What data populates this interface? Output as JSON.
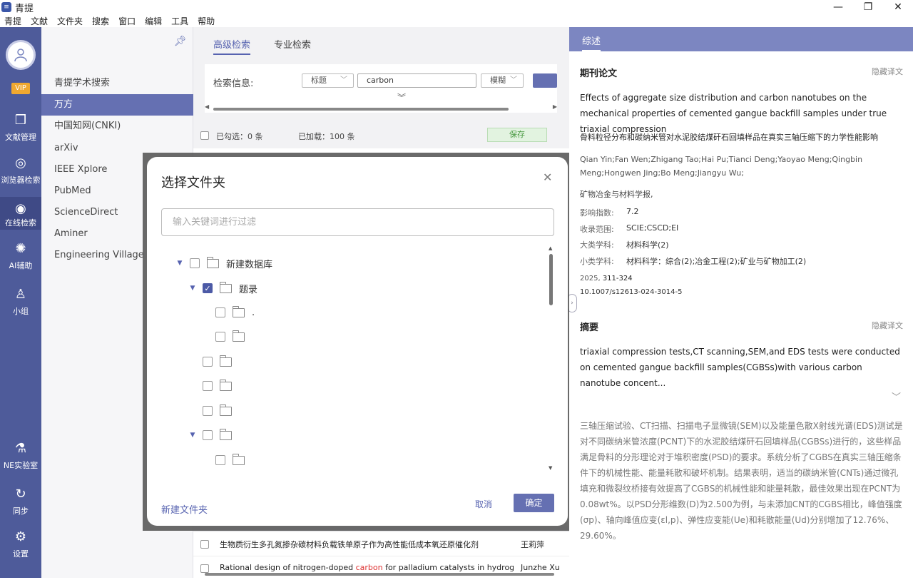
{
  "app": {
    "title": "青提",
    "logo_glyph": "≡"
  },
  "window_controls": {
    "minimize": "—",
    "maximize": "❐",
    "close": "✕"
  },
  "menu": [
    "青提",
    "文献",
    "文件夹",
    "搜索",
    "窗口",
    "编辑",
    "工具",
    "帮助"
  ],
  "rail": {
    "vip": "VIP",
    "items": [
      {
        "label": "文献管理",
        "icon": "box-icon"
      },
      {
        "label": "浏览器检索",
        "icon": "globe-icon"
      },
      {
        "label": "在线检索",
        "icon": "eye-icon"
      },
      {
        "label": "AI辅助",
        "icon": "bulb-icon"
      },
      {
        "label": "小组",
        "icon": "group-icon"
      },
      {
        "label": "NE实验室",
        "icon": "microscope-icon"
      },
      {
        "label": "同步",
        "icon": "sync-icon"
      },
      {
        "label": "设置",
        "icon": "gear-icon"
      }
    ]
  },
  "sources": [
    "青提学术搜索",
    "万方",
    "中国知网(CNKI)",
    "arXiv",
    "IEEE Xplore",
    "PubMed",
    "ScienceDirect",
    "Aminer",
    "Engineering Village"
  ],
  "search": {
    "tabs": [
      "高级检索",
      "专业检索"
    ],
    "label": "检索信息:",
    "field": "标题",
    "query": "carbon",
    "mode": "模糊"
  },
  "toolbar": {
    "selected": "已勾选：0 条",
    "loaded": "已加载：100 条",
    "save": "保存"
  },
  "results": [
    {
      "pre": "生物质衍生多孔氮掺杂碳材料负载铁单原子作为高性能低成本氧还原催化剂",
      "hl": "",
      "post": "",
      "author": "王莉萍"
    },
    {
      "pre": "Rational design of nitrogen-doped ",
      "hl": "carbon",
      "post": " for palladium catalysts in hydrogenation of h",
      "author": "Junzhe Xu"
    }
  ],
  "detail": {
    "tab": "综述",
    "section_paper": "期刊论文",
    "hide_translation": "隐藏译文",
    "title_en": "Effects of aggregate size distribution and carbon nanotubes on the mechanical properties of cemented gangue backfill samples under true triaxial compression",
    "title_cn": "骨料粒径分布和碳纳米管对水泥胶结煤矸石回填样品在真实三轴压缩下的力学性能影响",
    "authors": "Qian Yin;Fan Wen;Zhigang Tao;Hai Pu;Tianci Deng;Yaoyao Meng;Qingbin Meng;Hongwen Jing;Bo Meng;Jiangyu Wu;",
    "journal": "矿物冶金与材料学报,",
    "fields": [
      {
        "k": "影响指数:",
        "v": "7.2"
      },
      {
        "k": "收录范围:",
        "v": "SCIE;CSCD;EI"
      },
      {
        "k": "大类学科:",
        "v": "材料科学(2)"
      },
      {
        "k": "小类学科:",
        "v": "材料科学：综合(2);冶金工程(2);矿业与矿物加工(2)"
      }
    ],
    "year": "2025, ",
    "pages": "311-324",
    "doi": "10.1007/s12613-024-3014-5",
    "section_abstract": "摘要",
    "abstract_en": "triaxial compression tests,CT scanning,SEM,and EDS tests were conducted on cemented gangue backfill samples(CGBSs)with various carbon nanotube concent...",
    "abstract_cn": "三轴压缩试验、CT扫描、扫描电子显微镜(SEM)以及能量色散X射线光谱(EDS)测试是对不同碳纳米管浓度(PCNT)下的水泥胶结煤矸石回填样品(CGBSs)进行的，这些样品满足骨料的分形理论对于堆积密度(PSD)的要求。系统分析了CGBS在真实三轴压缩条件下的机械性能、能量耗散和破坏机制。结果表明，适当的碳纳米管(CNTs)通过微孔填充和微裂纹桥接有效提高了CGBS的机械性能和能量耗散，最佳效果出现在PCNT为0.08wt%。以PSD分形维数(D)为2.500为例，与未添加CNT的CGBS相比，峰值强度(σp)、轴向峰值应变(εl,p)、弹性应变能(Ue)和耗散能量(Ud)分别增加了12.76%、29.60%。"
  },
  "dialog": {
    "title": "选择文件夹",
    "filter_placeholder": "输入关键词进行过滤",
    "tree": [
      {
        "label": "新建数据库",
        "level": 0,
        "expanded": true,
        "checked": false
      },
      {
        "label": "题录",
        "level": 1,
        "expanded": true,
        "checked": true
      },
      {
        "label": ".",
        "level": 2,
        "expanded": null,
        "checked": false
      },
      {
        "label": "",
        "level": 2,
        "expanded": null,
        "checked": false
      },
      {
        "label": "",
        "level": 1,
        "expanded": null,
        "checked": false
      },
      {
        "label": "",
        "level": 1,
        "expanded": null,
        "checked": false
      },
      {
        "label": "",
        "level": 1,
        "expanded": null,
        "checked": false
      },
      {
        "label": "",
        "level": 1,
        "expanded": true,
        "checked": false
      },
      {
        "label": "",
        "level": 2,
        "expanded": null,
        "checked": false
      }
    ],
    "new_folder": "新建文件夹",
    "cancel": "取消",
    "ok": "确定"
  }
}
